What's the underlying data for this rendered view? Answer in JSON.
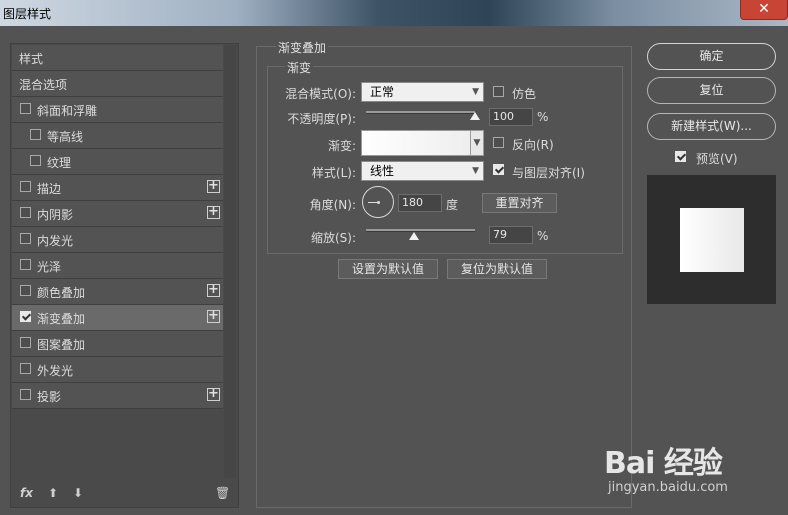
{
  "window": {
    "title": "图层样式",
    "close_label": "✕"
  },
  "left_panel": {
    "items": [
      {
        "label": "样式",
        "checkbox": false,
        "checked": false,
        "plus": false,
        "indent": 0,
        "selected": false
      },
      {
        "label": "混合选项",
        "checkbox": false,
        "checked": false,
        "plus": false,
        "indent": 0,
        "selected": false
      },
      {
        "label": "斜面和浮雕",
        "checkbox": true,
        "checked": false,
        "plus": false,
        "indent": 0,
        "selected": false
      },
      {
        "label": "等高线",
        "checkbox": true,
        "checked": false,
        "plus": false,
        "indent": 1,
        "selected": false
      },
      {
        "label": "纹理",
        "checkbox": true,
        "checked": false,
        "plus": false,
        "indent": 1,
        "selected": false
      },
      {
        "label": "描边",
        "checkbox": true,
        "checked": false,
        "plus": true,
        "indent": 0,
        "selected": false
      },
      {
        "label": "内阴影",
        "checkbox": true,
        "checked": false,
        "plus": true,
        "indent": 0,
        "selected": false
      },
      {
        "label": "内发光",
        "checkbox": true,
        "checked": false,
        "plus": false,
        "indent": 0,
        "selected": false
      },
      {
        "label": "光泽",
        "checkbox": true,
        "checked": false,
        "plus": false,
        "indent": 0,
        "selected": false
      },
      {
        "label": "颜色叠加",
        "checkbox": true,
        "checked": false,
        "plus": true,
        "indent": 0,
        "selected": false
      },
      {
        "label": "渐变叠加",
        "checkbox": true,
        "checked": true,
        "plus": true,
        "indent": 0,
        "selected": true
      },
      {
        "label": "图案叠加",
        "checkbox": true,
        "checked": false,
        "plus": false,
        "indent": 0,
        "selected": false
      },
      {
        "label": "外发光",
        "checkbox": true,
        "checked": false,
        "plus": false,
        "indent": 0,
        "selected": false
      },
      {
        "label": "投影",
        "checkbox": true,
        "checked": false,
        "plus": true,
        "indent": 0,
        "selected": false
      }
    ],
    "toolbar": {
      "fx": "fx",
      "up": "⬆",
      "down": "⬇",
      "trash": "🗑"
    }
  },
  "gradient_overlay": {
    "group_title": "渐变叠加",
    "sub_title": "渐变",
    "blend_mode_label": "混合模式(O):",
    "blend_mode_value": "正常",
    "dither_label": "仿色",
    "dither_checked": false,
    "opacity_label": "不透明度(P):",
    "opacity_value": "100",
    "opacity_fraction": 1.0,
    "percent": "%",
    "gradient_label": "渐变:",
    "reverse_label": "反向(R)",
    "reverse_checked": false,
    "style_label": "样式(L):",
    "style_value": "线性",
    "align_label": "与图层对齐(I)",
    "align_checked": true,
    "angle_label": "角度(N):",
    "angle_value": "180",
    "degree_unit": "度",
    "reset_align_label": "重置对齐",
    "scale_label": "缩放(S):",
    "scale_value": "79",
    "scale_fraction": 0.443,
    "set_default_label": "设置为默认值",
    "reset_default_label": "复位为默认值"
  },
  "right_panel": {
    "ok_label": "确定",
    "reset_label": "复位",
    "new_style_label": "新建样式(W)...",
    "preview_label": "预览(V)",
    "preview_checked": true
  },
  "watermark": {
    "brand": "Bai 经验",
    "url": "jingyan.baidu.com"
  }
}
